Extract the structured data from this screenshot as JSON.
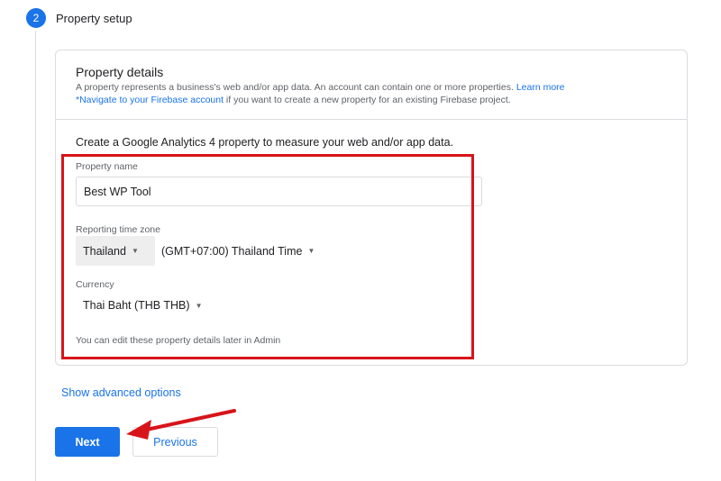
{
  "step": {
    "number": "2",
    "title": "Property setup"
  },
  "details": {
    "title": "Property details",
    "desc_line1": "A property represents a business's web and/or app data. An account can contain one or more properties. ",
    "learn_more": "Learn more",
    "firebase_link": "*Navigate to your Firebase account",
    "desc_line2_rest": " if you want to create a new property for an existing Firebase project."
  },
  "form": {
    "intro": "Create a Google Analytics 4 property to measure your web and/or app data.",
    "property_name_label": "Property name",
    "property_name_value": "Best WP Tool",
    "timezone_label": "Reporting time zone",
    "timezone_country": "Thailand",
    "timezone_value": "(GMT+07:00) Thailand Time",
    "currency_label": "Currency",
    "currency_value": "Thai Baht (THB THB)",
    "note": "You can edit these property details later in Admin"
  },
  "advanced_link": "Show advanced options",
  "buttons": {
    "next": "Next",
    "previous": "Previous"
  },
  "colors": {
    "accent": "#1a73e8",
    "annotation": "#d7141a"
  },
  "icons": {
    "caret": "caret-down-icon",
    "annotation_arrow": "red-arrow-icon"
  }
}
